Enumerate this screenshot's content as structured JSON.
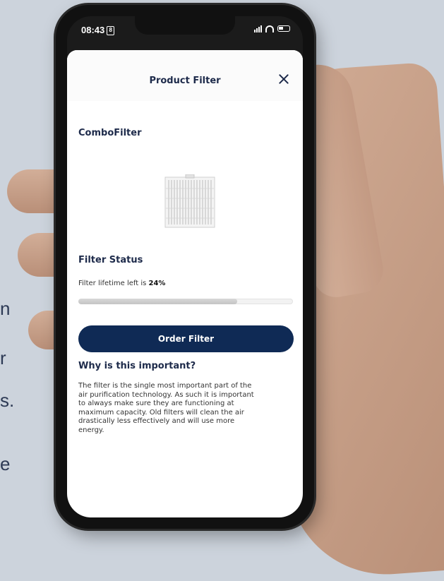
{
  "background": {
    "left_text_fragments": [
      "n",
      "r",
      "s.",
      "e"
    ]
  },
  "status_bar": {
    "time": "08:43",
    "time_badge": "8",
    "icons": [
      "signal-icon",
      "wifi-icon",
      "battery-icon"
    ]
  },
  "sheet": {
    "title": "Product Filter",
    "close_icon": "close-icon"
  },
  "product": {
    "name": "ComboFilter",
    "image_icon": "air-filter-image"
  },
  "filter_status": {
    "heading": "Filter Status",
    "lifetime_label": "Filter lifetime left is",
    "lifetime_value": "24%",
    "progress_fraction": 0.74
  },
  "order_button": {
    "label": "Order Filter"
  },
  "importance": {
    "heading": "Why is this important?",
    "body": "The filter is the single most important part of the air purification technology. As such it is important to always make sure they are functioning at maximum capacity. Old filters will clean the air drastically less effectively and will use more energy."
  },
  "colors": {
    "page_background": "#ccd3dc",
    "navy": "#0f2a55",
    "heading_text": "#1d2a4a"
  }
}
